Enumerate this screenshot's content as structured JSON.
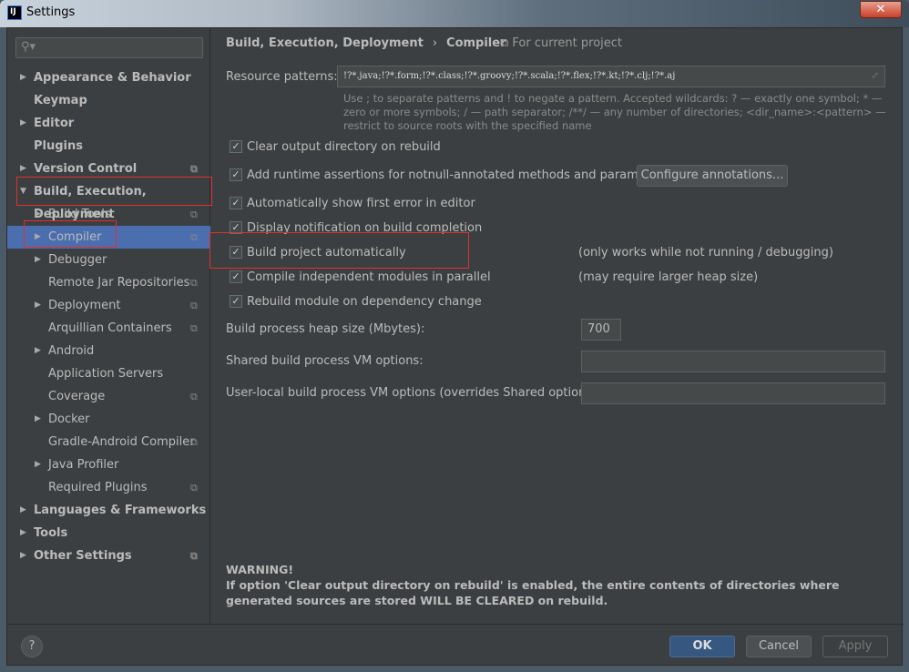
{
  "window": {
    "title": "Settings",
    "close": "✕"
  },
  "search": {
    "icon": "search-icon",
    "glyph": "⚲▾"
  },
  "sidebar": {
    "items": [
      {
        "label": "Appearance & Behavior",
        "level": 0,
        "arrow": "▶",
        "project": false
      },
      {
        "label": "Keymap",
        "level": 0,
        "arrow": "",
        "project": false
      },
      {
        "label": "Editor",
        "level": 0,
        "arrow": "▶",
        "project": false
      },
      {
        "label": "Plugins",
        "level": 0,
        "arrow": "",
        "project": false
      },
      {
        "label": "Version Control",
        "level": 0,
        "arrow": "▶",
        "project": true
      },
      {
        "label": "Build, Execution, Deployment",
        "level": 0,
        "arrow": "▼",
        "project": false
      },
      {
        "label": "Build Tools",
        "level": 1,
        "arrow": "▶",
        "project": true
      },
      {
        "label": "Compiler",
        "level": 1,
        "arrow": "▶",
        "project": true,
        "selected": true
      },
      {
        "label": "Debugger",
        "level": 1,
        "arrow": "▶",
        "project": false
      },
      {
        "label": "Remote Jar Repositories",
        "level": 1,
        "arrow": "",
        "project": true
      },
      {
        "label": "Deployment",
        "level": 1,
        "arrow": "▶",
        "project": true
      },
      {
        "label": "Arquillian Containers",
        "level": 1,
        "arrow": "",
        "project": true
      },
      {
        "label": "Android",
        "level": 1,
        "arrow": "▶",
        "project": false
      },
      {
        "label": "Application Servers",
        "level": 1,
        "arrow": "",
        "project": false
      },
      {
        "label": "Coverage",
        "level": 1,
        "arrow": "",
        "project": true
      },
      {
        "label": "Docker",
        "level": 1,
        "arrow": "▶",
        "project": false
      },
      {
        "label": "Gradle-Android Compiler",
        "level": 1,
        "arrow": "",
        "project": true
      },
      {
        "label": "Java Profiler",
        "level": 1,
        "arrow": "▶",
        "project": false
      },
      {
        "label": "Required Plugins",
        "level": 1,
        "arrow": "",
        "project": true
      },
      {
        "label": "Languages & Frameworks",
        "level": 0,
        "arrow": "▶",
        "project": false
      },
      {
        "label": "Tools",
        "level": 0,
        "arrow": "▶",
        "project": false
      },
      {
        "label": "Other Settings",
        "level": 0,
        "arrow": "▶",
        "project": true
      }
    ]
  },
  "breadcrumb": {
    "parent": "Build, Execution, Deployment",
    "sep": "›",
    "current": "Compiler",
    "scope": "⧉ For current project"
  },
  "resource": {
    "label": "Resource patterns:",
    "value": "!?*.java;!?*.form;!?*.class;!?*.groovy;!?*.scala;!?*.flex;!?*.kt;!?*.clj;!?*.aj",
    "hint": "Use ; to separate patterns and ! to negate a pattern. Accepted wildcards: ? — exactly one symbol; * — zero or more symbols; / — path separator; /**/ — any number of directories; <dir_name>:<pattern> — restrict to source roots with the specified name"
  },
  "options": [
    {
      "label": "Clear output directory on rebuild",
      "checked": true,
      "note": ""
    },
    {
      "label": "Add runtime assertions for notnull-annotated methods and parameters",
      "checked": true,
      "note": ""
    },
    {
      "label": "Automatically show first error in editor",
      "checked": true,
      "note": ""
    },
    {
      "label": "Display notification on build completion",
      "checked": true,
      "note": ""
    },
    {
      "label": "Build project automatically",
      "checked": true,
      "note": "(only works while not running / debugging)"
    },
    {
      "label": "Compile independent modules in parallel",
      "checked": true,
      "note": "(may require larger heap size)"
    },
    {
      "label": "Rebuild module on dependency change",
      "checked": true,
      "note": ""
    }
  ],
  "configure_annotations": "Configure annotations...",
  "fields": [
    {
      "label": "Build process heap size (Mbytes):",
      "value": "700"
    },
    {
      "label": "Shared build process VM options:",
      "value": ""
    },
    {
      "label": "User-local build process VM options (overrides Shared options):",
      "value": ""
    }
  ],
  "warning": {
    "title": "WARNING!",
    "text": "If option 'Clear output directory on rebuild' is enabled, the entire contents of directories where generated sources are stored WILL BE CLEARED on rebuild."
  },
  "footer": {
    "help": "?",
    "ok": "OK",
    "cancel": "Cancel",
    "apply": "Apply"
  },
  "colors": {
    "accent": "#4b6eaf",
    "ok": "#365880",
    "annotation": "#e03030"
  }
}
